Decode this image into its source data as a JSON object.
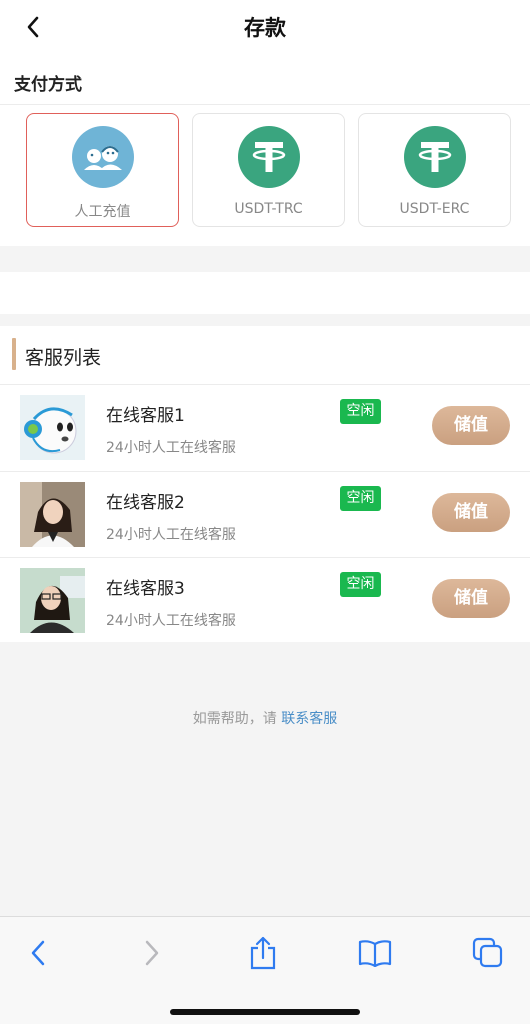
{
  "header": {
    "title": "存款"
  },
  "payment": {
    "label": "支付方式",
    "methods": [
      {
        "label": "人工充值",
        "selected": true,
        "icon": "customer-service-icon",
        "color": "#6fb4d6"
      },
      {
        "label": "USDT-TRC",
        "selected": false,
        "icon": "tether-icon",
        "color": "#3aa57f"
      },
      {
        "label": "USDT-ERC",
        "selected": false,
        "icon": "tether-icon",
        "color": "#3aa57f"
      }
    ]
  },
  "cs_list": {
    "title": "客服列表",
    "items": [
      {
        "name": "在线客服1",
        "desc": "24小时人工在线客服",
        "status": "空闲",
        "button": "储值",
        "avatar": "robot-avatar"
      },
      {
        "name": "在线客服2",
        "desc": "24小时人工在线客服",
        "status": "空闲",
        "button": "储值",
        "avatar": "agent-avatar"
      },
      {
        "name": "在线客服3",
        "desc": "24小时人工在线客服",
        "status": "空闲",
        "button": "储值",
        "avatar": "agent-avatar"
      }
    ]
  },
  "help": {
    "text": "如需帮助，请",
    "link": "联系客服"
  },
  "colors": {
    "accent": "#d8b18c",
    "status_green": "#1ab84f",
    "selected_border": "#e0605a",
    "link": "#4a8ec7",
    "ios_blue": "#2f7bf0"
  }
}
